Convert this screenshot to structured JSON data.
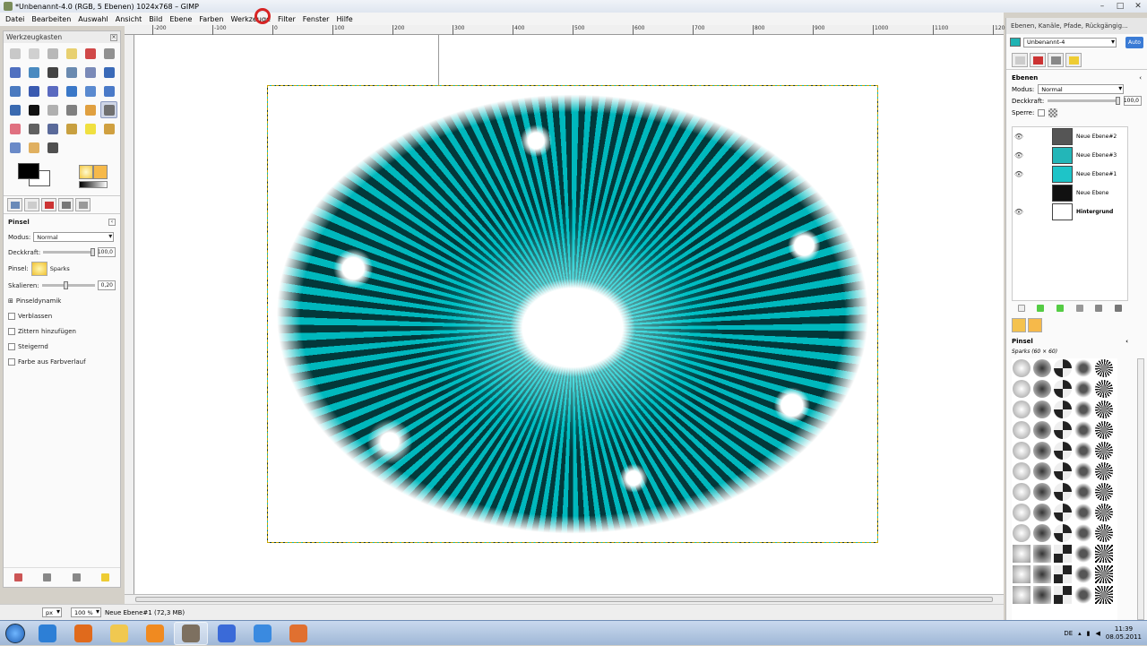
{
  "window": {
    "title": "*Unbenannt-4.0 (RGB, 5 Ebenen) 1024x768 – GIMP",
    "buttons": [
      "–",
      "□",
      "✕"
    ]
  },
  "menubar": [
    "Datei",
    "Bearbeiten",
    "Auswahl",
    "Ansicht",
    "Bild",
    "Ebene",
    "Farben",
    "Werkzeuge",
    "Filter",
    "Fenster",
    "Hilfe"
  ],
  "toolbox": {
    "title": "Werkzeugkasten",
    "tools": [
      {
        "icon": "rect-select-icon",
        "color": "#c8c8c8"
      },
      {
        "icon": "ellipse-select-icon",
        "color": "#d0d0d0"
      },
      {
        "icon": "lasso-icon",
        "color": "#b8b8b8"
      },
      {
        "icon": "fuzzy-select-icon",
        "color": "#e8d070"
      },
      {
        "icon": "color-select-icon",
        "color": "#d04848"
      },
      {
        "icon": "scissors-icon",
        "color": "#909090"
      },
      {
        "icon": "foreground-select-icon",
        "color": "#5070c0"
      },
      {
        "icon": "paths-icon",
        "color": "#4a8ac0"
      },
      {
        "icon": "color-picker-icon",
        "color": "#444444"
      },
      {
        "icon": "zoom-icon",
        "color": "#6a8ab0"
      },
      {
        "icon": "measure-icon",
        "color": "#7a8ab8"
      },
      {
        "icon": "move-icon",
        "color": "#3a6ab8"
      },
      {
        "icon": "align-icon",
        "color": "#4a7ac0"
      },
      {
        "icon": "crop-icon",
        "color": "#3a5ab0"
      },
      {
        "icon": "rotate-icon",
        "color": "#5a6ac0"
      },
      {
        "icon": "scale-icon",
        "color": "#3a78c8"
      },
      {
        "icon": "shear-icon",
        "color": "#5a8ad0"
      },
      {
        "icon": "perspective-icon",
        "color": "#4a7ac8"
      },
      {
        "icon": "flip-icon",
        "color": "#3a6ab0"
      },
      {
        "icon": "text-icon",
        "color": "#111111"
      },
      {
        "icon": "bucket-fill-icon",
        "color": "#b0b0b0"
      },
      {
        "icon": "blend-icon",
        "color": "#808080"
      },
      {
        "icon": "pencil-icon",
        "color": "#e0a040"
      },
      {
        "icon": "paintbrush-icon",
        "color": "#707070"
      },
      {
        "icon": "eraser-icon",
        "color": "#e07080"
      },
      {
        "icon": "airbrush-icon",
        "color": "#606060"
      },
      {
        "icon": "ink-icon",
        "color": "#5a6a9a"
      },
      {
        "icon": "clone-icon",
        "color": "#c8a040"
      },
      {
        "icon": "heal-icon",
        "color": "#f0e040"
      },
      {
        "icon": "perspective-clone-icon",
        "color": "#d0a040"
      },
      {
        "icon": "blur-icon",
        "color": "#6a8ac8"
      },
      {
        "icon": "smudge-icon",
        "color": "#e0b060"
      },
      {
        "icon": "dodge-burn-icon",
        "color": "#505050"
      }
    ],
    "active_tool_index": 23,
    "options": {
      "title": "Pinsel",
      "mode_label": "Modus:",
      "mode_value": "Normal",
      "opacity_label": "Deckkraft:",
      "opacity_value": "100,0",
      "brush_label": "Pinsel:",
      "brush_value": "Sparks",
      "scale_label": "Skalieren:",
      "scale_value": "0,20",
      "dynamics": "Pinseldynamik",
      "checks": [
        "Verblassen",
        "Zittern hinzufügen",
        "Steigernd",
        "Farbe aus Farbverlauf"
      ]
    }
  },
  "ruler": {
    "labels": [
      "-200",
      "-100",
      "0",
      "100",
      "200",
      "300",
      "400",
      "500",
      "600",
      "700",
      "800",
      "900",
      "1000",
      "1100",
      "1200"
    ]
  },
  "statusbar": {
    "unit": "px",
    "zoom": "100 %",
    "message": "Neue Ebene#1 (72,3 MB)"
  },
  "layers_dock": {
    "title": "Ebenen, Kanäle, Pfade, Rückgängig...",
    "image_name": "Unbenannt-4",
    "auto_button": "Auto",
    "section": "Ebenen",
    "mode_label": "Modus:",
    "mode_value": "Normal",
    "opacity_label": "Deckkraft:",
    "opacity_value": "100,0",
    "lock_label": "Sperre:",
    "layers": [
      {
        "name": "Neue Ebene#2",
        "visible": true,
        "thumb": "#555555",
        "bold": false
      },
      {
        "name": "Neue Ebene#3",
        "visible": true,
        "thumb": "#23b6b8",
        "bold": false
      },
      {
        "name": "Neue Ebene#1",
        "visible": true,
        "thumb": "#1ec4c8",
        "bold": false
      },
      {
        "name": "Neue Ebene",
        "visible": false,
        "thumb": "#111111",
        "bold": false
      },
      {
        "name": "Hintergrund",
        "visible": true,
        "thumb": "#ffffff",
        "bold": true
      }
    ]
  },
  "brushes_dock": {
    "title": "Pinsel",
    "current_brush": "Sparks (60 × 60)"
  },
  "taskbar": {
    "apps": [
      {
        "icon": "ie-icon",
        "color": "#2d7fd6"
      },
      {
        "icon": "firefox-icon",
        "color": "#e06a1c"
      },
      {
        "icon": "explorer-icon",
        "color": "#f0c850"
      },
      {
        "icon": "media-player-icon",
        "color": "#f08a20"
      },
      {
        "icon": "gimp-icon",
        "color": "#7d7060",
        "active": true
      },
      {
        "icon": "itunes-icon",
        "color": "#3a6ad8"
      },
      {
        "icon": "remote-desktop-icon",
        "color": "#3a8ae0"
      },
      {
        "icon": "recorder-icon",
        "color": "#e07030"
      }
    ],
    "language": "DE",
    "time": "11:39",
    "date": "08.05.2011"
  }
}
